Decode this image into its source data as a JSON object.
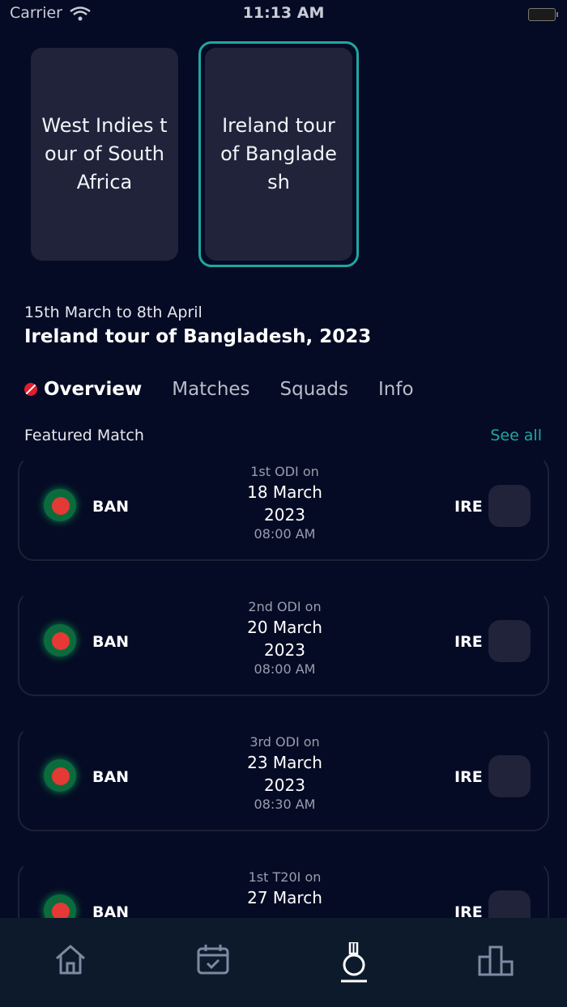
{
  "status": {
    "carrier": "Carrier",
    "time": "11:13 AM"
  },
  "tours": [
    {
      "name": "West Indies tour of South Africa",
      "selected": false
    },
    {
      "name": "Ireland tour of Bangladesh",
      "selected": true
    }
  ],
  "header": {
    "dates": "15th March to 8th April",
    "title": "Ireland tour of Bangladesh, 2023"
  },
  "tabs": [
    {
      "label": "Overview",
      "active": true
    },
    {
      "label": "Matches"
    },
    {
      "label": "Squads"
    },
    {
      "label": "Info"
    }
  ],
  "featured": {
    "label": "Featured Match",
    "see_all": "See all"
  },
  "matches": [
    {
      "team_a": "BAN",
      "team_b": "IRE",
      "label": "1st ODI on",
      "date": "18 March 2023",
      "time": "08:00 AM"
    },
    {
      "team_a": "BAN",
      "team_b": "IRE",
      "label": "2nd ODI on",
      "date": "20 March 2023",
      "time": "08:00 AM"
    },
    {
      "team_a": "BAN",
      "team_b": "IRE",
      "label": "3rd ODI on",
      "date": "23 March 2023",
      "time": "08:30 AM"
    },
    {
      "team_a": "BAN",
      "team_b": "IRE",
      "label": "1st T20I on",
      "date": "27 March",
      "time": ""
    }
  ],
  "nav": [
    {
      "icon": "home-icon"
    },
    {
      "icon": "calendar-check-icon"
    },
    {
      "icon": "cricket-icon",
      "active": true
    },
    {
      "icon": "leaderboard-icon"
    }
  ],
  "colors": {
    "background": "#050b24",
    "card": "#20233a",
    "accent": "#1fa7a1",
    "live": "#e11d2d",
    "nav_bg": "#0d1a2b"
  }
}
